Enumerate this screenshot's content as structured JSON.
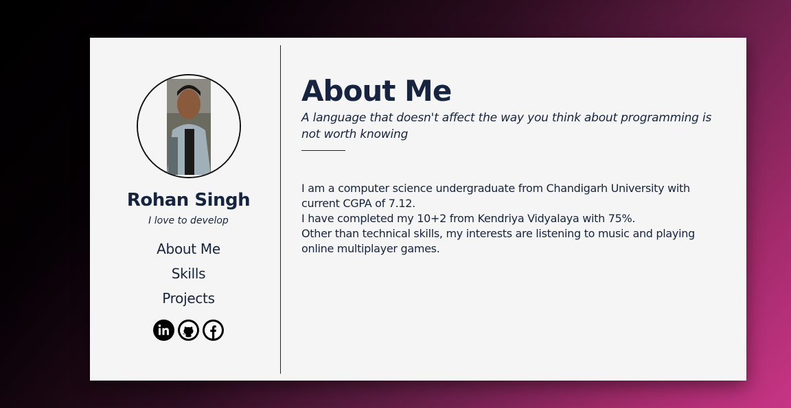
{
  "profile": {
    "name": "Rohan Singh",
    "tagline": "I love to develop",
    "avatar_alt": "profile photo"
  },
  "nav": {
    "items": [
      {
        "label": "About Me"
      },
      {
        "label": "Skills"
      },
      {
        "label": "Projects"
      }
    ]
  },
  "socials": [
    {
      "name": "linkedin-icon"
    },
    {
      "name": "github-icon"
    },
    {
      "name": "facebook-icon"
    }
  ],
  "about": {
    "title": "About Me",
    "quote": "A language that doesn't affect the way you think about programming is not worth knowing",
    "bio": [
      "I am a computer science undergraduate from  Chandigarh University with current CGPA of 7.12.",
      "I have completed my 10+2 from Kendriya Vidyalaya  with 75%.",
      "Other than technical skills, my interests are listening to music and playing online multiplayer games."
    ]
  },
  "colors": {
    "text": "#16243f",
    "card": "#f5f5f5",
    "accent": "#c83585"
  }
}
